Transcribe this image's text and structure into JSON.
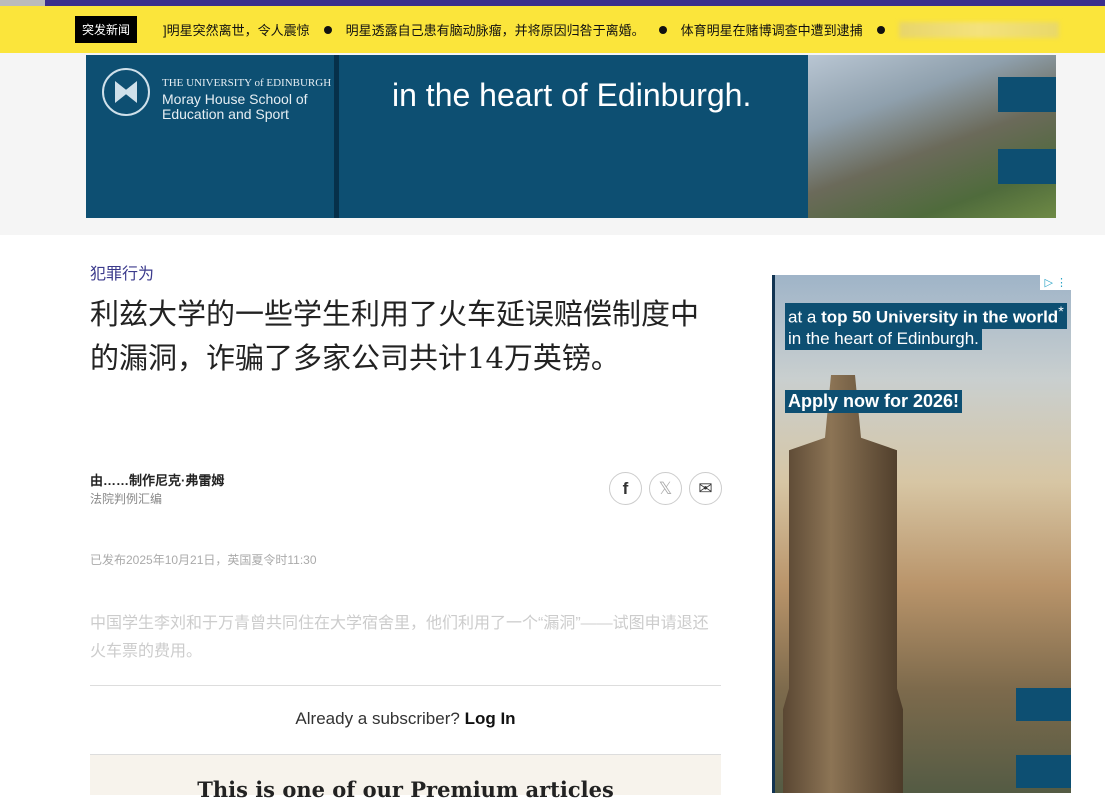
{
  "ticker": {
    "badge": "突发新闻",
    "items": [
      "]明星突然离世，令人震惊",
      "明星透露自己患有脑动脉瘤，并将原因归咎于离婚。",
      "体育明星在赌博调查中遭到逮捕"
    ]
  },
  "banner": {
    "university": "THE UNIVERSITY of EDINBURGH",
    "school": "Moray House School of Education and Sport",
    "tagline": "in the heart of Edinburgh."
  },
  "article": {
    "category": "犯罪行为",
    "title": "利兹大学的一些学生利用了火车延误赔偿制度中的漏洞，诈骗了多家公司共计14万英镑。",
    "byline": "由……制作尼克·弗雷姆",
    "source": "法院判例汇编",
    "published": "已发布2025年10月21日，英国夏令时11:30",
    "lede": "中国学生李刘和于万青曾共同住在大学宿舍里，他们利用了一个“漏洞”——试图申请退还火车票的费用。"
  },
  "share": {
    "facebook": "f",
    "x": "𝕏",
    "email": "✉"
  },
  "paywall": {
    "prompt": "Already a subscriber?",
    "login": "Log In",
    "premium": "This is one of our Premium articles"
  },
  "ad": {
    "choices": "▷ ⋮",
    "line1_pre": "at a ",
    "line1_bold": "top 50 University in the world",
    "line1_star": "*",
    "line2": "in the heart of Edinburgh.",
    "cta": "Apply now for 2026!"
  }
}
